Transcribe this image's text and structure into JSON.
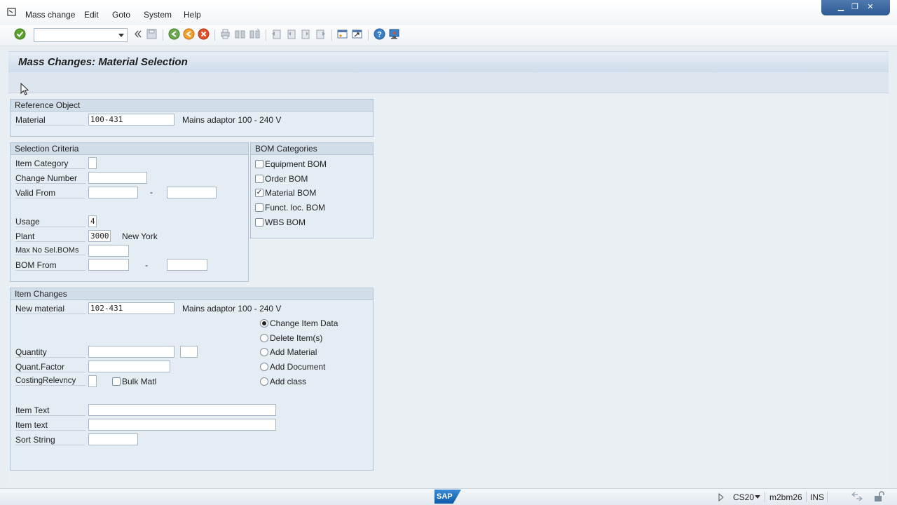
{
  "menubar": {
    "items": [
      "Mass change",
      "Edit",
      "Goto",
      "System",
      "Help"
    ]
  },
  "window_controls": [
    "minimize",
    "restore",
    "close"
  ],
  "toolbar": {
    "command_field_value": "",
    "icons": [
      "enter-icon",
      "back-double-icon",
      "save-icon",
      "back-icon",
      "exit-icon",
      "cancel-icon",
      "print-icon",
      "find-icon",
      "find-next-icon",
      "first-page-icon",
      "previous-page-icon",
      "next-page-icon",
      "last-page-icon",
      "create-session-icon",
      "shortcut-icon",
      "help-icon",
      "customize-layout-icon"
    ]
  },
  "page": {
    "title": "Mass Changes: Material Selection"
  },
  "reference_object": {
    "heading": "Reference Object",
    "material_label": "Material",
    "material_value": "100-431",
    "material_desc": "Mains adaptor 100 - 240 V"
  },
  "selection_criteria": {
    "heading": "Selection Criteria",
    "item_category_label": "Item Category",
    "item_category_value": "",
    "change_number_label": "Change Number",
    "change_number_value": "",
    "valid_from_label": "Valid From",
    "valid_from_value": "",
    "valid_to_value": "",
    "range_dash": "-",
    "usage_label": "Usage",
    "usage_value": "4",
    "plant_label": "Plant",
    "plant_value": "3000",
    "plant_desc": "New York",
    "max_no_label": "Max No Sel.BOMs",
    "max_no_value": "",
    "bom_from_label": "BOM From",
    "bom_from_value": "",
    "bom_to_value": ""
  },
  "bom_categories": {
    "heading": "BOM Categories",
    "options": [
      {
        "label": "Equipment BOM",
        "checked": false
      },
      {
        "label": "Order BOM",
        "checked": false
      },
      {
        "label": "Material BOM",
        "checked": true
      },
      {
        "label": "Funct. loc. BOM",
        "checked": false
      },
      {
        "label": "WBS BOM",
        "checked": false
      }
    ],
    "check_mark": "✓"
  },
  "item_changes": {
    "heading": "Item Changes",
    "new_material_label": "New material",
    "new_material_value": "102-431",
    "new_material_desc": "Mains adaptor 100 - 240 V",
    "quantity_label": "Quantity",
    "quantity_value": "",
    "quantity_unit": "",
    "quant_factor_label": "Quant.Factor",
    "quant_factor_value": "",
    "costing_label": "CostingRelevncy",
    "costing_value": "",
    "bulk_label": "Bulk Matl",
    "bulk_checked": false,
    "item_text_label": "Item Text",
    "item_text_value": "",
    "item_text2_label": "Item text",
    "item_text2_value": "",
    "sort_string_label": "Sort String",
    "sort_string_value": "",
    "actions": [
      {
        "label": "Change Item Data",
        "selected": true
      },
      {
        "label": "Delete Item(s)",
        "selected": false
      },
      {
        "label": "Add Material",
        "selected": false
      },
      {
        "label": "Add Document",
        "selected": false
      },
      {
        "label": "Add class",
        "selected": false
      }
    ]
  },
  "statusbar": {
    "logo": "SAP",
    "transaction": "CS20",
    "server": "m2bm26",
    "mode": "INS"
  }
}
